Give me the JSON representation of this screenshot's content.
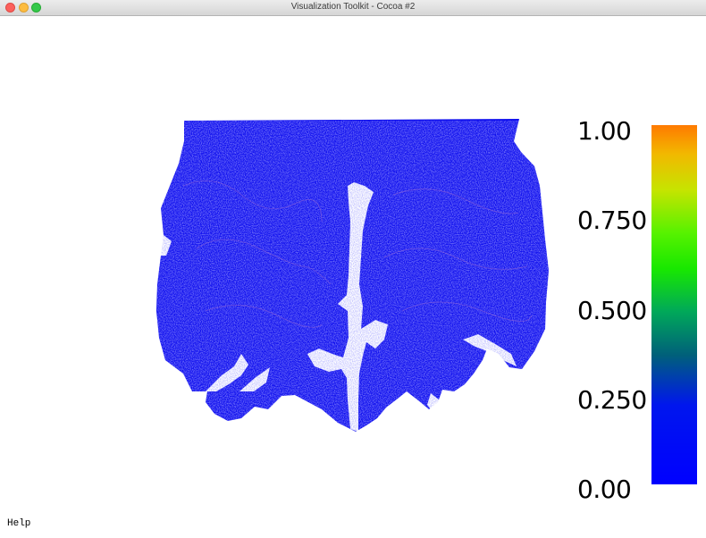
{
  "window": {
    "title": "Visualization Toolkit - Cocoa #2"
  },
  "scalar_bar": {
    "labels": [
      "1.00",
      "0.750",
      "0.500",
      "0.250",
      "0.00"
    ],
    "colormap": [
      "#ff7a00",
      "#c6e400",
      "#18e800",
      "#00607a",
      "#0000ff"
    ]
  },
  "render": {
    "object_color": "#1010ee",
    "background_color": "#ffffff"
  },
  "help_text": "Help"
}
